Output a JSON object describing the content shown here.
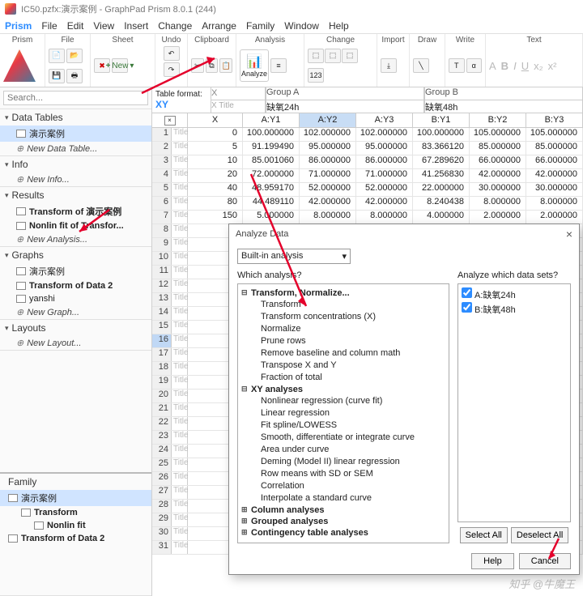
{
  "title": "IC50.pzfx:演示案例 - GraphPad Prism 8.0.1 (244)",
  "menu": [
    "Prism",
    "File",
    "Edit",
    "View",
    "Insert",
    "Change",
    "Arrange",
    "Family",
    "Window",
    "Help"
  ],
  "toolbar": {
    "groups": [
      "Prism",
      "File",
      "Sheet",
      "Undo",
      "Clipboard",
      "Analysis",
      "Change",
      "Import",
      "Draw",
      "Write",
      "Text"
    ],
    "analyze": "Analyze",
    "new": "New"
  },
  "search": {
    "placeholder": "Search..."
  },
  "panels": {
    "data_tables": {
      "title": "Data Tables",
      "items": [
        "演示案例"
      ],
      "new": "New Data Table..."
    },
    "info": {
      "title": "Info",
      "new": "New Info..."
    },
    "results": {
      "title": "Results",
      "items": [
        "Transform of 演示案例",
        "Nonlin fit of Transfor..."
      ],
      "new": "New Analysis..."
    },
    "graphs": {
      "title": "Graphs",
      "items": [
        "演示案例",
        "Transform of Data 2",
        "yanshi"
      ],
      "new": "New Graph..."
    },
    "layouts": {
      "title": "Layouts",
      "new": "New Layout..."
    }
  },
  "family": {
    "title": "Family",
    "root": "演示案例",
    "items": [
      "Transform",
      "Nonlin fit",
      "Transform of Data 2"
    ]
  },
  "table": {
    "format_label": "Table format:",
    "format": "XY",
    "x_title_ph": "X Title",
    "x_label": "X",
    "group_a": {
      "name": "Group A",
      "sub": "缺氧24h",
      "cols": [
        "A:Y1",
        "A:Y2",
        "A:Y3"
      ]
    },
    "group_b": {
      "name": "Group B",
      "sub": "缺氧48h",
      "cols": [
        "B:Y1",
        "B:Y2",
        "B:Y3"
      ]
    },
    "title_ph": "Title",
    "rows": [
      {
        "n": 1,
        "x": "0",
        "a": [
          "100.000000",
          "102.000000",
          "102.000000"
        ],
        "b": [
          "100.000000",
          "105.000000",
          "105.000000"
        ]
      },
      {
        "n": 2,
        "x": "5",
        "a": [
          "91.199490",
          "95.000000",
          "95.000000"
        ],
        "b": [
          "83.366120",
          "85.000000",
          "85.000000"
        ]
      },
      {
        "n": 3,
        "x": "10",
        "a": [
          "85.001060",
          "86.000000",
          "86.000000"
        ],
        "b": [
          "67.289620",
          "66.000000",
          "66.000000"
        ]
      },
      {
        "n": 4,
        "x": "20",
        "a": [
          "72.000000",
          "71.000000",
          "71.000000"
        ],
        "b": [
          "41.256830",
          "42.000000",
          "42.000000"
        ]
      },
      {
        "n": 5,
        "x": "40",
        "a": [
          "48.959170",
          "52.000000",
          "52.000000"
        ],
        "b": [
          "22.000000",
          "30.000000",
          "30.000000"
        ]
      },
      {
        "n": 6,
        "x": "80",
        "a": [
          "44.489110",
          "42.000000",
          "42.000000"
        ],
        "b": [
          "8.240438",
          "8.000000",
          "8.000000"
        ]
      },
      {
        "n": 7,
        "x": "150",
        "a": [
          "5.000000",
          "8.000000",
          "8.000000"
        ],
        "b": [
          "4.000000",
          "2.000000",
          "2.000000"
        ]
      }
    ],
    "empty_rows": [
      8,
      9,
      10,
      11,
      12,
      13,
      14,
      15,
      16,
      17,
      18,
      19,
      20,
      21,
      22,
      23,
      24,
      25,
      26,
      27,
      28,
      29,
      30,
      31
    ]
  },
  "dialog": {
    "title": "Analyze Data",
    "combo": "Built-in analysis",
    "q_left": "Which analysis?",
    "q_right": "Analyze which data sets?",
    "tree": {
      "cats": [
        {
          "name": "Transform, Normalize...",
          "open": true,
          "items": [
            "Transform",
            "Transform concentrations (X)",
            "Normalize",
            "Prune rows",
            "Remove baseline and column math",
            "Transpose X and Y",
            "Fraction of total"
          ]
        },
        {
          "name": "XY analyses",
          "open": true,
          "items": [
            "Nonlinear regression (curve fit)",
            "Linear regression",
            "Fit spline/LOWESS",
            "Smooth, differentiate or integrate curve",
            "Area under curve",
            "Deming (Model II) linear regression",
            "Row means with SD or SEM",
            "Correlation",
            "Interpolate a standard curve"
          ]
        },
        {
          "name": "Column analyses",
          "open": false
        },
        {
          "name": "Grouped analyses",
          "open": false
        },
        {
          "name": "Contingency table analyses",
          "open": false
        }
      ]
    },
    "datasets": [
      "A:缺氧24h",
      "B:缺氧48h"
    ],
    "btns": {
      "select_all": "Select All",
      "deselect_all": "Deselect All",
      "help": "Help",
      "cancel": "Cancel"
    }
  },
  "watermark": "知乎 @牛魔王"
}
